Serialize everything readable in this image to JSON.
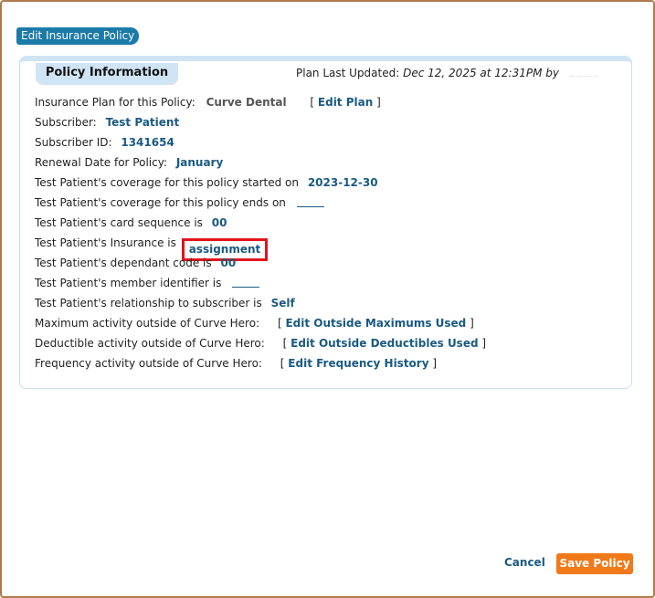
{
  "dialog": {
    "title": "Edit Insurance Policy"
  },
  "panel": {
    "tab_label": "Policy Information",
    "updated_label": "Plan Last Updated:",
    "updated_date": "Dec 12, 2025 at 12:31PM by"
  },
  "fields": {
    "plan_label": "Insurance Plan for this Policy:",
    "plan_value": "Curve Dental",
    "edit_plan": "Edit Plan",
    "subscriber_label": "Subscriber:",
    "subscriber_value": "Test Patient",
    "subscriber_id_label": "Subscriber ID:",
    "subscriber_id_value": "1341654",
    "renewal_label": "Renewal Date for Policy:",
    "renewal_value": "January",
    "coverage_start_label": "Test Patient's coverage for this policy started on",
    "coverage_start_value": "2023-12-30",
    "coverage_end_label": "Test Patient's coverage for this policy ends on",
    "card_seq_label": "Test Patient's card sequence is",
    "card_seq_value": "00",
    "insurance_label": "Test Patient's Insurance is",
    "insurance_value": "assignment",
    "dependant_label": "Test Patient's dependant code is",
    "dependant_value": "00",
    "member_id_label": "Test Patient's member identifier is",
    "relationship_label": "Test Patient's relationship to subscriber is",
    "relationship_value": "Self",
    "max_label": "Maximum activity outside of Curve Hero:",
    "max_link": "Edit Outside Maximums Used",
    "deduct_label": "Deductible activity outside of Curve Hero:",
    "deduct_link": "Edit Outside Deductibles Used",
    "freq_label": "Frequency activity outside of Curve Hero:",
    "freq_link": "Edit Frequency History"
  },
  "footer": {
    "cancel_label": "Cancel",
    "save_label": "Save Policy"
  },
  "colors": {
    "accent": "#1b7aa8",
    "link": "#1a5a82",
    "save_button": "#f07a1a",
    "highlight": "#e3141c"
  }
}
